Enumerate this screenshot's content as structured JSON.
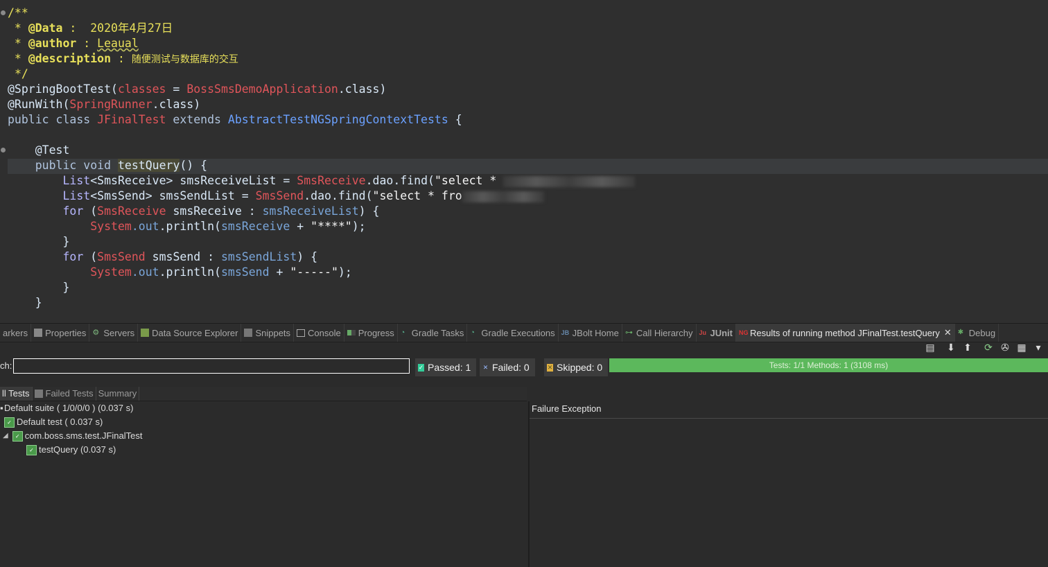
{
  "editor": {
    "comment_open": "/**",
    "data_tag": "@Data",
    "data_sep": " :  ",
    "data_value": "2020年4月27日",
    "author_tag": "@author",
    "author_sep": " : ",
    "author_value": "Leaual",
    "desc_tag": "@description",
    "desc_sep": " : ",
    "desc_value": "随便测试与数据库的交互",
    "comment_close": "*/",
    "ann1_name": "@SpringBootTest",
    "ann1_param": "classes",
    "ann1_eq": " = ",
    "ann1_cls": "BossSmsDemoApplication",
    "ann1_suffix": ".class)",
    "ann2_name": "@RunWith",
    "ann2_cls": "SpringRunner",
    "ann2_suffix": ".class)",
    "class_kw": "public class ",
    "class_name": "JFinalTest",
    "extends_kw": " extends ",
    "super_name": "AbstractTestNGSpringContextTests",
    "class_brace": " {",
    "test_ann": "@Test",
    "method_kw": "public void ",
    "method_name": "testQuery",
    "method_tail": "() {",
    "l1_type": "List",
    "l1_gen": "<SmsReceive>",
    "l1_var": " smsReceiveList = ",
    "l1_cls": "SmsReceive",
    "l1_call": ".dao.find(",
    "l1_str": "\"select * ",
    "l2_type": "List",
    "l2_gen": "<SmsSend>",
    "l2_var": " smsSendList = ",
    "l2_cls": "SmsSend",
    "l2_call": ".dao.find(",
    "l2_str": "\"select * fro",
    "for1_kw": "for",
    "for1_open": " (",
    "for1_cls": "SmsReceive",
    "for1_var": " smsReceive : ",
    "for1_list": "smsReceiveList",
    "for1_close": ") {",
    "p1_sys": "System",
    "p1_out": ".out",
    "p1_call": ".println(",
    "p1_var": "smsReceive",
    "p1_plus": " + ",
    "p1_str": "\"****\"",
    "p1_end": ");",
    "close1": "}",
    "for2_kw": "for",
    "for2_open": " (",
    "for2_cls": "SmsSend",
    "for2_var": " smsSend : ",
    "for2_list": "smsSendList",
    "for2_close": ") {",
    "p2_sys": "System",
    "p2_out": ".out",
    "p2_call": ".println(",
    "p2_var": "smsSend",
    "p2_plus": " + ",
    "p2_str": "\"-----\"",
    "p2_end": ");",
    "close2": "}",
    "close3": "}"
  },
  "views_tabs": [
    {
      "label": "arkers",
      "icon": "markers-icon"
    },
    {
      "label": "Properties",
      "icon": "properties-icon"
    },
    {
      "label": "Servers",
      "icon": "servers-icon"
    },
    {
      "label": "Data Source Explorer",
      "icon": "database-icon"
    },
    {
      "label": "Snippets",
      "icon": "snippets-icon"
    },
    {
      "label": "Console",
      "icon": "console-icon"
    },
    {
      "label": "Progress",
      "icon": "progress-icon"
    },
    {
      "label": "Gradle Tasks",
      "icon": "gradle-icon"
    },
    {
      "label": "Gradle Executions",
      "icon": "gradle-icon"
    },
    {
      "label": "JBolt Home",
      "icon": "jbolt-icon"
    },
    {
      "label": "Call Hierarchy",
      "icon": "hierarchy-icon"
    },
    {
      "label": "JUnit",
      "icon": "junit-icon"
    },
    {
      "label": "Results of running method JFinalTest.testQuery",
      "icon": "testng-icon"
    },
    {
      "label": "Debug",
      "icon": "debug-icon"
    }
  ],
  "search": {
    "label": "ch:",
    "value": ""
  },
  "counters": {
    "passed": "Passed: 1",
    "failed": "Failed: 0",
    "skipped": "Skipped: 0"
  },
  "progress": {
    "text": "Tests: 1/1  Methods: 1 (3108 ms)",
    "fraction": 1.0,
    "color": "#5cb85c"
  },
  "subtabs": [
    "ll Tests",
    "Failed Tests",
    "Summary"
  ],
  "tree": {
    "suite": "Default suite ( 1/0/0/0 ) (0.037 s)",
    "test": "Default test ( 0.037 s)",
    "class": "com.boss.sms.test.JFinalTest",
    "method": "testQuery  (0.037 s)"
  },
  "failure": {
    "title": "Failure Exception"
  }
}
